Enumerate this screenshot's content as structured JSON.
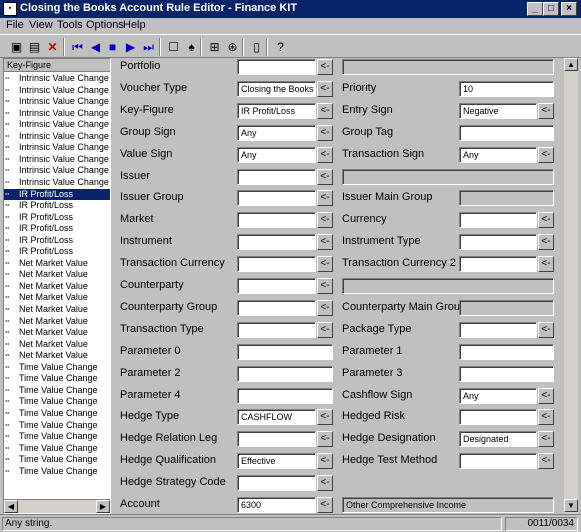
{
  "window": {
    "title": "Closing the Books Account Rule Editor - Finance KIT"
  },
  "menu": [
    "File",
    "View",
    "Tools",
    "Options",
    "Help"
  ],
  "toolbar_icons": [
    "save-icon",
    "save-as-icon",
    "delete-icon",
    "first-record-icon",
    "previous-record-icon",
    "stop-icon",
    "next-record-icon",
    "last-record-icon",
    "new-record-icon",
    "find-icon",
    "structure-icon",
    "binoculars-icon",
    "page-icon",
    "help-icon"
  ],
  "left_panel": {
    "header": "Key-Figure",
    "items": [
      "Intrinsic Value Change",
      "Intrinsic Value Change",
      "Intrinsic Value Change",
      "Intrinsic Value Change",
      "Intrinsic Value Change",
      "Intrinsic Value Change",
      "Intrinsic Value Change",
      "Intrinsic Value Change",
      "Intrinsic Value Change",
      "Intrinsic Value Change",
      "IR Profit/Loss",
      "IR Profit/Loss",
      "IR Profit/Loss",
      "IR Profit/Loss",
      "IR Profit/Loss",
      "IR Profit/Loss",
      "Net Market Value",
      "Net Market Value",
      "Net Market Value",
      "Net Market Value",
      "Net Market Value",
      "Net Market Value",
      "Net Market Value",
      "Net Market Value",
      "Net Market Value",
      "Time Value Change",
      "Time Value Change",
      "Time Value Change",
      "Time Value Change",
      "Time Value Change",
      "Time Value Change",
      "Time Value Change",
      "Time Value Change",
      "Time Value Change",
      "Time Value Change"
    ],
    "selected_index": 10
  },
  "form": {
    "portfolio": {
      "label": "Portfolio",
      "value": ""
    },
    "voucher_type": {
      "label": "Voucher Type",
      "value": "Closing the Books"
    },
    "key_figure": {
      "label": "Key-Figure",
      "value": "IR Profit/Loss"
    },
    "group_sign": {
      "label": "Group Sign",
      "value": "Any"
    },
    "value_sign": {
      "label": "Value Sign",
      "value": "Any"
    },
    "issuer": {
      "label": "Issuer",
      "value": ""
    },
    "issuer_group": {
      "label": "Issuer Group",
      "value": ""
    },
    "market": {
      "label": "Market",
      "value": ""
    },
    "instrument": {
      "label": "Instrument",
      "value": ""
    },
    "transaction_currency": {
      "label": "Transaction Currency",
      "value": ""
    },
    "counterparty": {
      "label": "Counterparty",
      "value": ""
    },
    "counterparty_group": {
      "label": "Counterparty Group",
      "value": ""
    },
    "transaction_type": {
      "label": "Transaction Type",
      "value": ""
    },
    "parameter0": {
      "label": "Parameter 0",
      "value": ""
    },
    "parameter2": {
      "label": "Parameter 2",
      "value": ""
    },
    "parameter4": {
      "label": "Parameter 4",
      "value": ""
    },
    "hedge_type": {
      "label": "Hedge Type",
      "value": "CASHFLOW"
    },
    "hedge_relation_leg": {
      "label": "Hedge Relation Leg",
      "value": ""
    },
    "hedge_qualification": {
      "label": "Hedge Qualification",
      "value": "Effective"
    },
    "hedge_strategy_code": {
      "label": "Hedge Strategy Code",
      "value": ""
    },
    "account": {
      "label": "Account",
      "value": "6300",
      "description": "Other Comprehensive Income"
    },
    "priority": {
      "label": "Priority",
      "value": "10"
    },
    "entry_sign": {
      "label": "Entry Sign",
      "value": "Negative"
    },
    "group_tag": {
      "label": "Group Tag",
      "value": ""
    },
    "transaction_sign": {
      "label": "Transaction Sign",
      "value": "Any"
    },
    "issuer_main_group": {
      "label": "Issuer Main Group",
      "value": ""
    },
    "currency": {
      "label": "Currency",
      "value": ""
    },
    "instrument_type": {
      "label": "Instrument Type",
      "value": ""
    },
    "transaction_currency2": {
      "label": "Transaction Currency 2",
      "value": ""
    },
    "counterparty_main_group": {
      "label": "Counterparty Main Group",
      "value": ""
    },
    "package_type": {
      "label": "Package Type",
      "value": ""
    },
    "parameter1": {
      "label": "Parameter 1",
      "value": ""
    },
    "parameter3": {
      "label": "Parameter 3",
      "value": ""
    },
    "cashflow_sign": {
      "label": "Cashflow Sign",
      "value": "Any"
    },
    "hedged_risk": {
      "label": "Hedged Risk",
      "value": ""
    },
    "hedge_designation": {
      "label": "Hedge Designation",
      "value": "Designated"
    },
    "hedge_test_method": {
      "label": "Hedge Test Method",
      "value": ""
    }
  },
  "lookup_glyph": "<-",
  "status": {
    "message": "Any string.",
    "record": "0011/0034"
  }
}
